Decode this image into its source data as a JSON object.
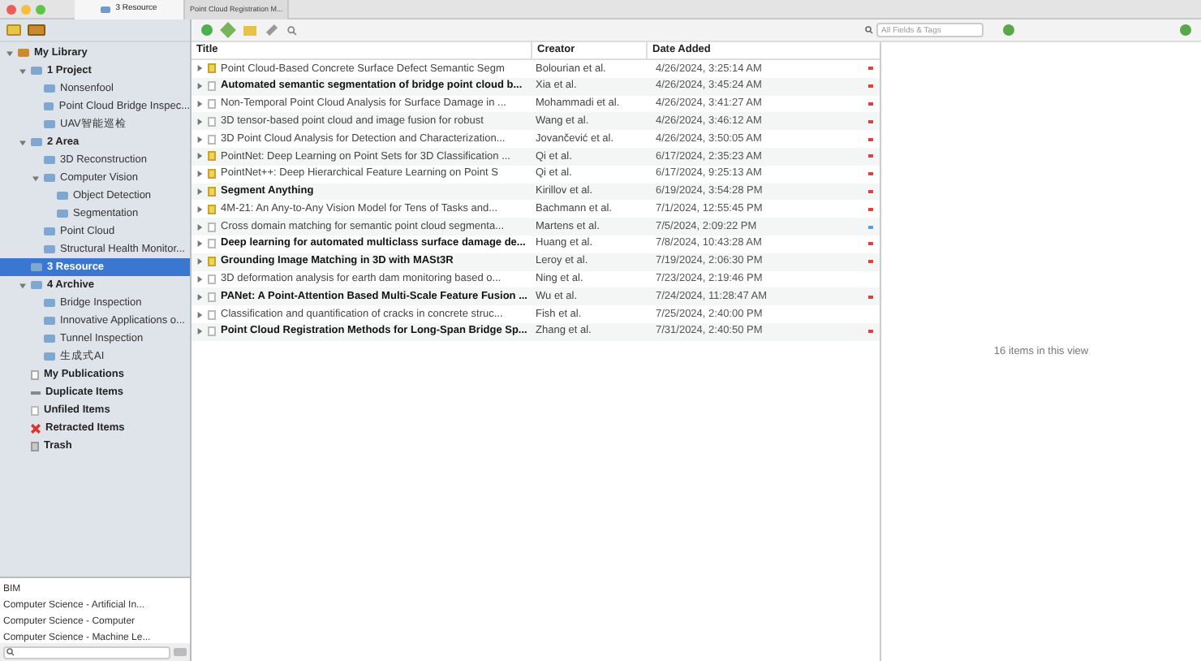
{
  "tabs": [
    {
      "label": "3 Resource",
      "selected": true
    },
    {
      "label": "Point Cloud Registration M...",
      "selected": false
    }
  ],
  "search": {
    "placeholder": "All Fields & Tags"
  },
  "collections": [
    {
      "label": "My Library",
      "kind": "library",
      "expanded": true,
      "selected": false,
      "children": [
        {
          "label": "1 Project",
          "kind": "folder",
          "expanded": true,
          "selected": false,
          "children": [
            {
              "label": "Nonsenfool",
              "kind": "folder",
              "selected": false
            },
            {
              "label": "Point Cloud Bridge Inspec...",
              "kind": "folder",
              "selected": false
            },
            {
              "label": "UAV智能巡检",
              "kind": "folder",
              "selected": false
            }
          ]
        },
        {
          "label": "2 Area",
          "kind": "folder",
          "expanded": true,
          "selected": false,
          "children": [
            {
              "label": "3D Reconstruction",
              "kind": "folder",
              "selected": false
            },
            {
              "label": "Computer Vision",
              "kind": "folder",
              "expanded": true,
              "selected": false,
              "children": [
                {
                  "label": "Object Detection",
                  "kind": "folder",
                  "selected": false
                },
                {
                  "label": "Segmentation",
                  "kind": "folder",
                  "selected": false
                }
              ]
            },
            {
              "label": "Point Cloud",
              "kind": "folder",
              "selected": false
            },
            {
              "label": "Structural Health Monitor...",
              "kind": "folder",
              "selected": false
            }
          ]
        },
        {
          "label": "3 Resource",
          "kind": "folder",
          "selected": true
        },
        {
          "label": "4 Archive",
          "kind": "folder",
          "expanded": true,
          "selected": false,
          "children": [
            {
              "label": "Bridge Inspection",
              "kind": "folder",
              "selected": false
            },
            {
              "label": "Innovative Applications o...",
              "kind": "folder",
              "selected": false
            },
            {
              "label": "Tunnel Inspection",
              "kind": "folder",
              "selected": false
            },
            {
              "label": "生成式AI",
              "kind": "folder",
              "selected": false
            }
          ]
        },
        {
          "label": "My Publications",
          "kind": "publications",
          "selected": false
        },
        {
          "label": "Duplicate Items",
          "kind": "duplicates",
          "selected": false
        },
        {
          "label": "Unfiled Items",
          "kind": "unfiled",
          "selected": false
        },
        {
          "label": "Retracted Items",
          "kind": "retracted",
          "selected": false
        },
        {
          "label": "Trash",
          "kind": "trash",
          "selected": false
        }
      ]
    }
  ],
  "tags": [
    "BIM",
    "Computer Science - Artificial In...",
    "Computer Science - Computer",
    "Computer Science - Machine Le..."
  ],
  "table": {
    "columns": [
      "Title",
      "Creator",
      "Date Added"
    ],
    "rows": [
      {
        "kind": "preprint",
        "bold": false,
        "title": "Point Cloud-Based Concrete Surface Defect Semantic Segm",
        "creator": "Bolourian et al.",
        "date": "4/26/2024, 3:25:14 AM",
        "color": "#e04040"
      },
      {
        "kind": "article",
        "bold": true,
        "title": "Automated semantic segmentation of bridge point cloud b...",
        "creator": "Xia et al.",
        "date": "4/26/2024, 3:45:24 AM",
        "color": "#e04040"
      },
      {
        "kind": "article",
        "bold": false,
        "title": "Non-Temporal Point Cloud Analysis for Surface Damage in ...",
        "creator": "Mohammadi et al.",
        "date": "4/26/2024, 3:41:27 AM",
        "color": "#e04040"
      },
      {
        "kind": "article",
        "bold": false,
        "title": "3D tensor-based point cloud and image fusion for robust",
        "creator": "Wang et al.",
        "date": "4/26/2024, 3:46:12 AM",
        "color": "#e04040"
      },
      {
        "kind": "article",
        "bold": false,
        "title": "3D Point Cloud Analysis for Detection and Characterization...",
        "creator": "Jovančević et al.",
        "date": "4/26/2024, 3:50:05 AM",
        "color": "#e04040"
      },
      {
        "kind": "preprint",
        "bold": false,
        "title": "PointNet: Deep Learning on Point Sets for 3D Classification ...",
        "creator": "Qi et al.",
        "date": "6/17/2024, 2:35:23 AM",
        "color": "#e04040"
      },
      {
        "kind": "preprint",
        "bold": false,
        "title": "PointNet++: Deep Hierarchical Feature Learning on Point S",
        "creator": "Qi et al.",
        "date": "6/17/2024, 9:25:13 AM",
        "color": "#e04040"
      },
      {
        "kind": "preprint",
        "bold": true,
        "title": "Segment Anything",
        "creator": "Kirillov et al.",
        "date": "6/19/2024, 3:54:28 PM",
        "color": "#e04040"
      },
      {
        "kind": "preprint",
        "bold": false,
        "title": "4M-21: An Any-to-Any Vision Model for Tens of Tasks and...",
        "creator": "Bachmann et al.",
        "date": "7/1/2024, 12:55:45 PM",
        "color": "#e04040"
      },
      {
        "kind": "article",
        "bold": false,
        "title": "Cross domain matching for semantic point cloud segmenta...",
        "creator": "Martens et al.",
        "date": "7/5/2024, 2:09:22 PM",
        "color": "#5aa0e0"
      },
      {
        "kind": "article",
        "bold": true,
        "title": "Deep learning for automated multiclass surface damage de...",
        "creator": "Huang et al.",
        "date": "7/8/2024, 10:43:28 AM",
        "color": "#e04040"
      },
      {
        "kind": "preprint",
        "bold": true,
        "title": "Grounding Image Matching in 3D with MASt3R",
        "creator": "Leroy et al.",
        "date": "7/19/2024, 2:06:30 PM",
        "color": "#e04040"
      },
      {
        "kind": "article",
        "bold": false,
        "title": "3D deformation analysis for earth dam monitoring based o...",
        "creator": "Ning et al.",
        "date": "7/23/2024, 2:19:46 PM"
      },
      {
        "kind": "article",
        "bold": true,
        "title": "PANet: A Point-Attention Based Multi-Scale Feature Fusion ...",
        "creator": "Wu et al.",
        "date": "7/24/2024, 11:28:47 AM",
        "color": "#e04040"
      },
      {
        "kind": "article",
        "bold": false,
        "title": "Classification and quantification of cracks in concrete struc...",
        "creator": "Fish et al.",
        "date": "7/25/2024, 2:40:00 PM"
      },
      {
        "kind": "article",
        "bold": true,
        "title": "Point Cloud Registration Methods for Long-Span Bridge Sp...",
        "creator": "Zhang et al.",
        "date": "7/31/2024, 2:40:50 PM",
        "color": "#e04040"
      }
    ]
  },
  "item_pane": {
    "message": "16 items in this view"
  }
}
